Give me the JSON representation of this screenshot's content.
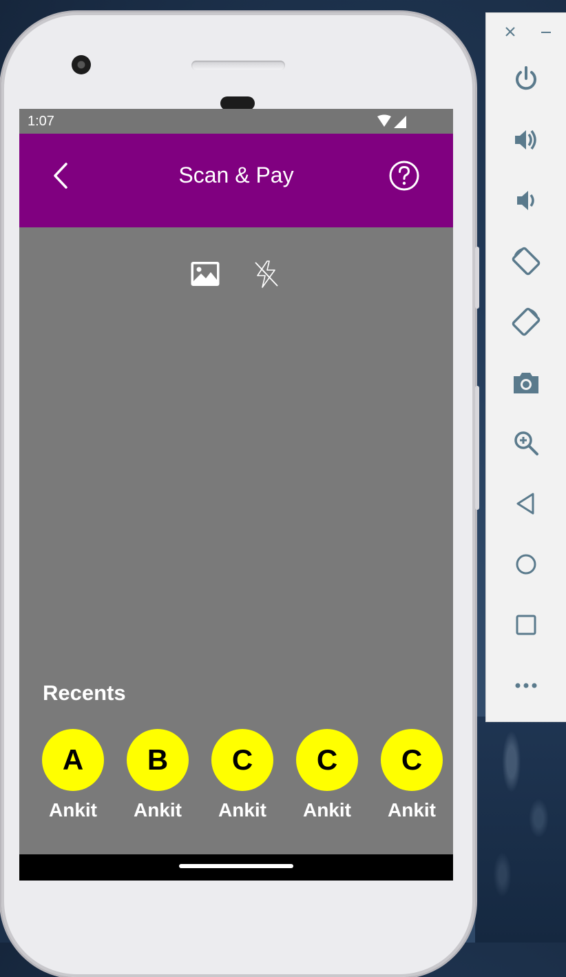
{
  "status_bar": {
    "time": "1:07"
  },
  "app_bar": {
    "title": "Scan & Pay"
  },
  "recents": {
    "title": "Recents",
    "items": [
      {
        "initial": "A",
        "name": "Ankit"
      },
      {
        "initial": "B",
        "name": "Ankit"
      },
      {
        "initial": "C",
        "name": "Ankit"
      },
      {
        "initial": "C",
        "name": "Ankit"
      },
      {
        "initial": "C",
        "name": "Ankit"
      }
    ]
  },
  "colors": {
    "app_bar": "#800080",
    "camera_area": "#7a7a7a",
    "avatar": "#ffff00",
    "emulator_icon": "#5a7a8c"
  },
  "emulator_toolbar": {
    "icons": [
      "close-icon",
      "minimize-icon",
      "power-icon",
      "volume-up-icon",
      "volume-down-icon",
      "rotate-left-icon",
      "rotate-right-icon",
      "camera-icon",
      "zoom-icon",
      "back-icon",
      "home-icon",
      "overview-icon",
      "more-icon"
    ]
  }
}
